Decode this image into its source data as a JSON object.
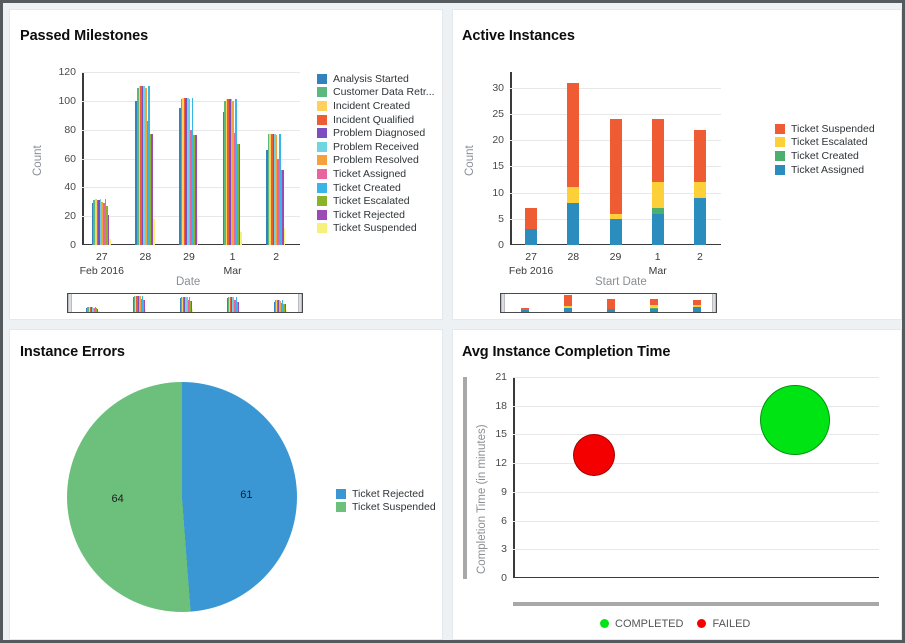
{
  "panels": {
    "passed_milestones": {
      "title": "Passed Milestones"
    },
    "active_instances": {
      "title": "Active Instances"
    },
    "instance_errors": {
      "title": "Instance Errors"
    },
    "completion_time": {
      "title": "Avg Instance Completion Time"
    }
  },
  "chart_data": [
    {
      "id": "passed-milestones",
      "type": "bar",
      "title": "Passed Milestones",
      "xlabel": "Date",
      "ylabel": "Count",
      "ylim": [
        0,
        120
      ],
      "yticks": [
        0,
        20,
        40,
        60,
        80,
        100,
        120
      ],
      "grid": true,
      "legend_position": "right",
      "categories": [
        "27",
        "28",
        "29",
        "1",
        "2"
      ],
      "category_sublabels": [
        "Feb 2016",
        "",
        "",
        "Mar",
        ""
      ],
      "series": [
        {
          "name": "Analysis Started",
          "color": "#3182bd",
          "values": [
            29,
            100,
            95,
            92,
            66
          ]
        },
        {
          "name": "Customer Data Retr...",
          "color": "#59b97f",
          "values": [
            31,
            109,
            101,
            100,
            77
          ]
        },
        {
          "name": "Incident Created",
          "color": "#ffd05b",
          "values": [
            32,
            110,
            102,
            101,
            77
          ]
        },
        {
          "name": "Incident Qualified",
          "color": "#ef5b33",
          "values": [
            31,
            110,
            102,
            101,
            77
          ]
        },
        {
          "name": "Problem Diagnosed",
          "color": "#7d4ec1",
          "values": [
            31,
            110,
            102,
            101,
            77
          ]
        },
        {
          "name": "Problem Received",
          "color": "#6fd6e0",
          "values": [
            32,
            110,
            102,
            101,
            77
          ]
        },
        {
          "name": "Problem Resolved",
          "color": "#f5a23c",
          "values": [
            30,
            109,
            101,
            100,
            76
          ]
        },
        {
          "name": "Ticket Assigned",
          "color": "#e9639f",
          "values": [
            29,
            86,
            80,
            78,
            60
          ]
        },
        {
          "name": "Ticket Created",
          "color": "#38b6e8",
          "values": [
            32,
            110,
            102,
            101,
            77
          ]
        },
        {
          "name": "Ticket Escalated",
          "color": "#8bb328",
          "values": [
            27,
            77,
            76,
            70,
            52
          ]
        },
        {
          "name": "Ticket Rejected",
          "color": "#9c4bb5",
          "values": [
            21,
            77,
            76,
            70,
            52
          ]
        },
        {
          "name": "Ticket Suspended",
          "color": "#f7f07a",
          "values": [
            4,
            18,
            18,
            9,
            12
          ]
        }
      ]
    },
    {
      "id": "active-instances",
      "type": "bar",
      "stacked": true,
      "title": "Active Instances",
      "xlabel": "Start Date",
      "ylabel": "Count",
      "ylim": [
        0,
        33
      ],
      "yticks": [
        0,
        5,
        10,
        15,
        20,
        25,
        30
      ],
      "grid": true,
      "legend_position": "right",
      "categories": [
        "27",
        "28",
        "29",
        "1",
        "2"
      ],
      "category_sublabels": [
        "Feb 2016",
        "",
        "",
        "Mar",
        ""
      ],
      "series": [
        {
          "name": "Ticket Assigned",
          "color": "#2b8cbe",
          "values": [
            3,
            8,
            5,
            6,
            9
          ]
        },
        {
          "name": "Ticket Created",
          "color": "#4daf6e",
          "values": [
            0,
            0,
            0,
            1,
            0
          ]
        },
        {
          "name": "Ticket Escalated",
          "color": "#fdd03a",
          "values": [
            0,
            3,
            1,
            5,
            3
          ]
        },
        {
          "name": "Ticket Suspended",
          "color": "#ef5b33",
          "values": [
            4,
            20,
            18,
            12,
            10
          ]
        }
      ],
      "totals": [
        7,
        31,
        24,
        24,
        22
      ]
    },
    {
      "id": "instance-errors",
      "type": "pie",
      "title": "Instance Errors",
      "legend_position": "right",
      "slices": [
        {
          "label": "Ticket Rejected",
          "value": 61,
          "color": "#3b97d3"
        },
        {
          "label": "Ticket Suspended",
          "value": 64,
          "color": "#6cc07c"
        }
      ]
    },
    {
      "id": "avg-instance-completion-time",
      "type": "scatter",
      "title": "Avg Instance Completion Time",
      "ylabel": "Completion Time (in minutes)",
      "ylim": [
        0,
        21
      ],
      "yticks": [
        0,
        3,
        6,
        9,
        12,
        15,
        18,
        21
      ],
      "grid": true,
      "legend_position": "bottom",
      "points": [
        {
          "label": "FAILED",
          "color": "#f40000",
          "x": 0.22,
          "y": 12.8,
          "radius": 21
        },
        {
          "label": "COMPLETED",
          "color": "#00e414",
          "x": 0.77,
          "y": 16.5,
          "radius": 35
        }
      ],
      "legend": [
        {
          "label": "COMPLETED",
          "color": "#00e414"
        },
        {
          "label": "FAILED",
          "color": "#f40000"
        }
      ]
    }
  ]
}
